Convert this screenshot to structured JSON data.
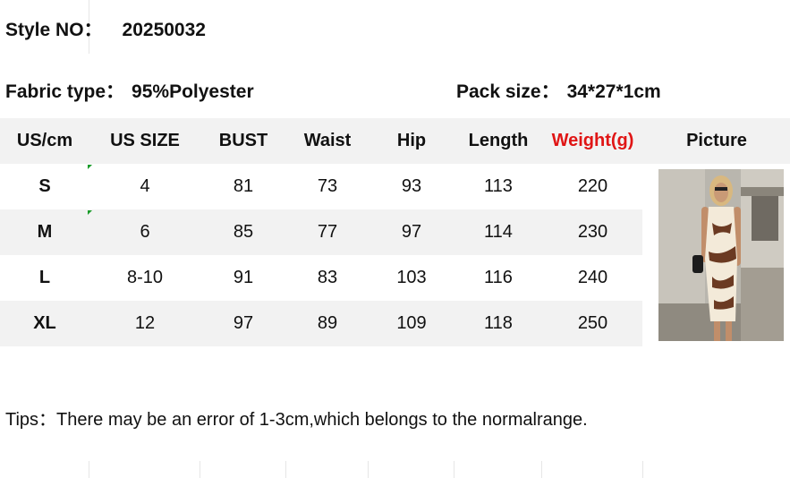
{
  "style_no": {
    "label": "Style NO：",
    "value": "20250032"
  },
  "fabric": {
    "label": "Fabric type：",
    "value": "95%Polyester"
  },
  "pack": {
    "label": "Pack size：",
    "value": "34*27*1cm"
  },
  "table": {
    "headers": [
      "US/cm",
      "US SIZE",
      "BUST",
      "Waist",
      "Hip",
      "Length",
      "Weight(g)",
      "Picture"
    ],
    "rows": [
      [
        "S",
        "4",
        "81",
        "73",
        "93",
        "113",
        "220"
      ],
      [
        "M",
        "6",
        "85",
        "77",
        "97",
        "114",
        "230"
      ],
      [
        "L",
        "8-10",
        "91",
        "83",
        "103",
        "116",
        "240"
      ],
      [
        "XL",
        "12",
        "97",
        "89",
        "109",
        "118",
        "250"
      ]
    ]
  },
  "tips": "Tips：There may be an error of 1-3cm,which belongs to the normalrange.",
  "colors": {
    "band": "#f2f2f2",
    "weight_header": "#e01515"
  }
}
